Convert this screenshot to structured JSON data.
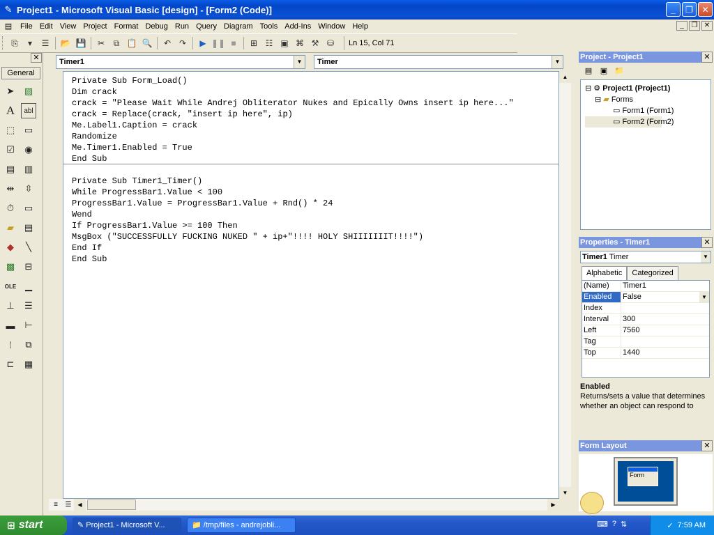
{
  "window": {
    "title": "Project1 - Microsoft Visual Basic [design] - [Form2 (Code)]",
    "icon": "vb-icon"
  },
  "menu": [
    "File",
    "Edit",
    "View",
    "Project",
    "Format",
    "Debug",
    "Run",
    "Query",
    "Diagram",
    "Tools",
    "Add-Ins",
    "Window",
    "Help"
  ],
  "toolbar": {
    "position": "Ln 15, Col 71"
  },
  "toolbox": {
    "tab": "General"
  },
  "code": {
    "object_combo": "Timer1",
    "proc_combo": "Timer",
    "proc1": "Private Sub Form_Load()\nDim crack\ncrack = \"Please Wait While Andrej Obliterator Nukes and Epically Owns insert ip here...\"\ncrack = Replace(crack, \"insert ip here\", ip)\nMe.Label1.Caption = crack\nRandomize\nMe.Timer1.Enabled = True\nEnd Sub",
    "proc2": "Private Sub Timer1_Timer()\nWhile ProgressBar1.Value < 100\nProgressBar1.Value = ProgressBar1.Value + Rnd() * 24\nWend\nIf ProgressBar1.Value >= 100 Then\nMsgBox (\"SUCCESSFULLY FUCKING NUKED \" + ip+\"!!!! HOLY SHIIIIIIIT!!!!\")\nEnd If\nEnd Sub"
  },
  "project": {
    "header": "Project - Project1",
    "root": "Project1 (Project1)",
    "folder": "Forms",
    "items": [
      "Form1 (Form1)",
      "Form2 (Form2)"
    ]
  },
  "properties": {
    "header": "Properties - Timer1",
    "object_name": "Timer1",
    "object_type": "Timer",
    "tabs": [
      "Alphabetic",
      "Categorized"
    ],
    "rows": [
      {
        "k": "(Name)",
        "v": "Timer1"
      },
      {
        "k": "Enabled",
        "v": "False"
      },
      {
        "k": "Index",
        "v": ""
      },
      {
        "k": "Interval",
        "v": "300"
      },
      {
        "k": "Left",
        "v": "7560"
      },
      {
        "k": "Tag",
        "v": ""
      },
      {
        "k": "Top",
        "v": "1440"
      }
    ],
    "desc_title": "Enabled",
    "desc_text": "Returns/sets a value that determines whether an object can respond to"
  },
  "layout": {
    "header": "Form Layout",
    "form_label": "Form"
  },
  "taskbar": {
    "start": "start",
    "items": [
      "Project1 - Microsoft V...",
      "/tmp/files - andrejobli..."
    ],
    "clock": "7:59 AM"
  }
}
